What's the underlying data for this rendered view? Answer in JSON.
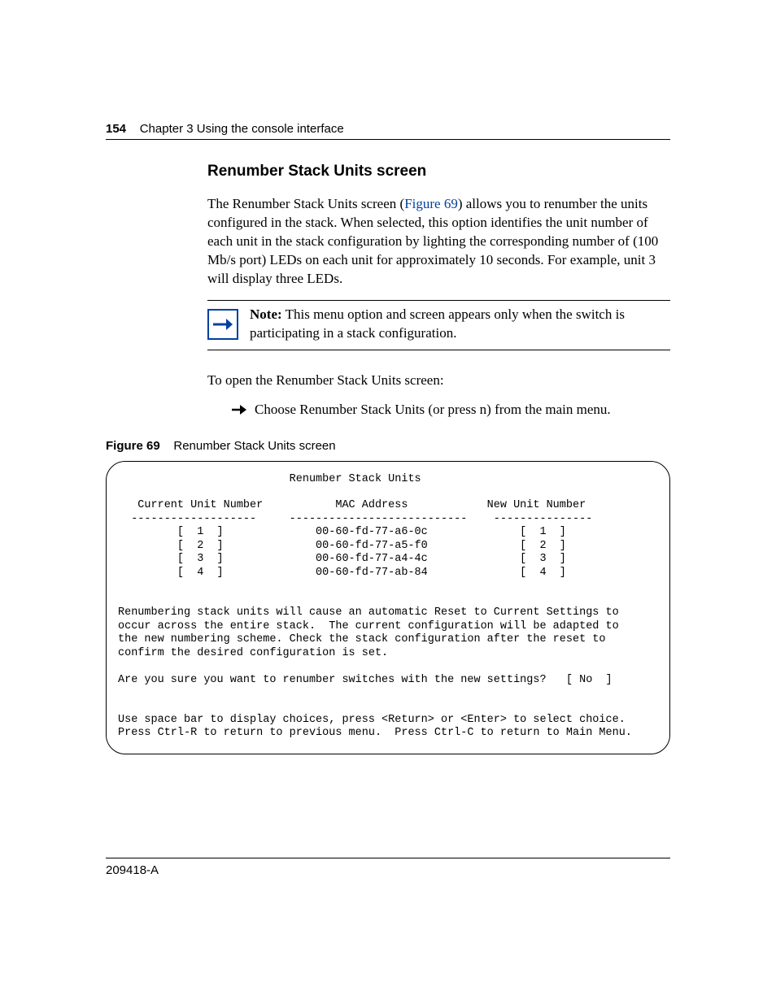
{
  "header": {
    "page_number": "154",
    "chapter_line": "Chapter 3  Using the console interface"
  },
  "section": {
    "title": "Renumber Stack Units screen",
    "para1_a": "The Renumber Stack Units screen (",
    "para1_xref": "Figure 69",
    "para1_b": ") allows you to renumber the units configured in the stack. When selected, this option identifies the unit number of each unit in the stack configuration by lighting the corresponding number of (100 Mb/s port) LEDs on each unit for approximately 10 seconds. For example, unit 3 will display three LEDs.",
    "note_label": "Note:",
    "note_text": " This menu option and screen appears only when the switch is participating in a stack configuration.",
    "para2": "To open the Renumber Stack Units screen:",
    "step1": "Choose Renumber Stack Units (or press n) from the main menu."
  },
  "figure": {
    "label": "Figure 69",
    "caption": "Renumber Stack Units screen",
    "terminal": "                          Renumber Stack Units\n\n   Current Unit Number           MAC Address            New Unit Number\n  -------------------     ---------------------------    ---------------\n         [  1  ]              00-60-fd-77-a6-0c              [  1  ]\n         [  2  ]              00-60-fd-77-a5-f0              [  2  ]\n         [  3  ]              00-60-fd-77-a4-4c              [  3  ]\n         [  4  ]              00-60-fd-77-ab-84              [  4  ]\n\n\nRenumbering stack units will cause an automatic Reset to Current Settings to\noccur across the entire stack.  The current configuration will be adapted to\nthe new numbering scheme. Check the stack configuration after the reset to\nconfirm the desired configuration is set.\n\nAre you sure you want to renumber switches with the new settings?   [ No  ]\n\n\nUse space bar to display choices, press <Return> or <Enter> to select choice.\nPress Ctrl-R to return to previous menu.  Press Ctrl-C to return to Main Menu."
  },
  "footer": {
    "docnum": "209418-A"
  }
}
